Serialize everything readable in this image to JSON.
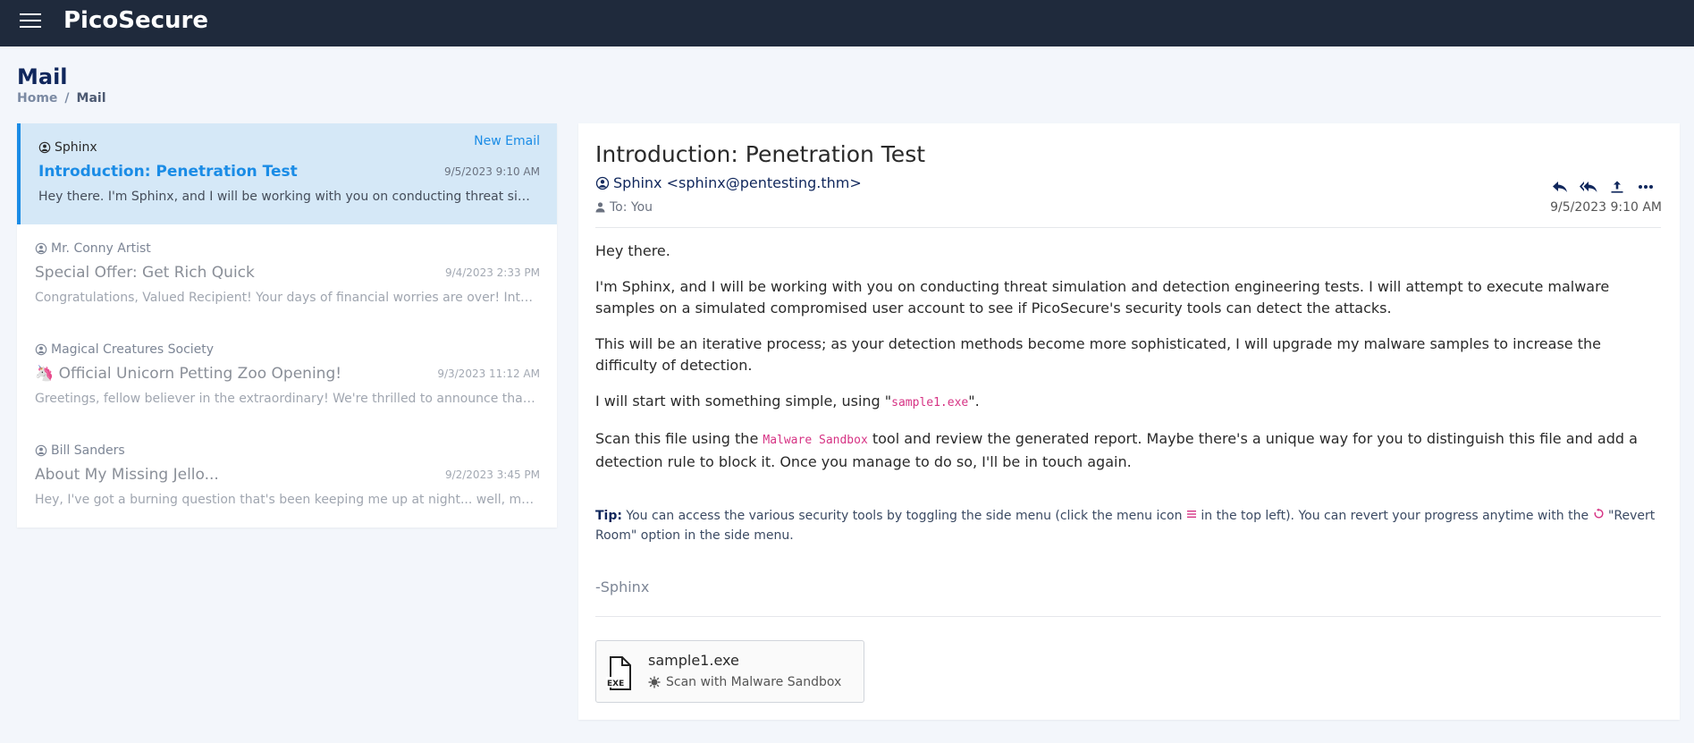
{
  "app": {
    "brand": "PicoSecure"
  },
  "page": {
    "title": "Mail",
    "breadcrumb": {
      "home": "Home",
      "separator": "/",
      "current": "Mail"
    }
  },
  "mail_list": [
    {
      "sender": "Sphinx",
      "tag": "New Email",
      "subject": "Introduction: Penetration Test",
      "date": "9/5/2023 9:10 AM",
      "preview": "Hey there. I'm Sphinx, and I will be working with you on conducting threat simulation and detection engineering tests.",
      "active": true
    },
    {
      "sender": "Mr. Conny Artist",
      "subject": "Special Offer: Get Rich Quick",
      "date": "9/4/2023 2:33 PM",
      "preview": "Congratulations, Valued Recipient! Your days of financial worries are over! Introducing our revolutionary system.",
      "active": false
    },
    {
      "sender": "Magical Creatures Society",
      "subject": "🦄 Official Unicorn Petting Zoo Opening!",
      "date": "9/3/2023 11:12 AM",
      "preview": "Greetings, fellow believer in the extraordinary! We're thrilled to announce that the Magical Creatures Society.",
      "active": false
    },
    {
      "sender": "Bill Sanders",
      "subject": "About My Missing Jello...",
      "date": "9/2/2023 3:45 PM",
      "preview": "Hey, I've got a burning question that's been keeping me up at night... well, maybe not literally.",
      "active": false
    }
  ],
  "email": {
    "title": "Introduction: Penetration Test",
    "from": "Sphinx <sphinx@pentesting.thm>",
    "to": "To: You",
    "date": "9/5/2023 9:10 AM",
    "greeting": "Hey there.",
    "p1": "I'm Sphinx, and I will be working with you on conducting threat simulation and detection engineering tests. I will attempt to execute malware samples on a simulated compromised user account to see if PicoSecure's security tools can detect the attacks.",
    "p2": "This will be an iterative process; as your detection methods become more sophisticated, I will upgrade my malware samples to increase the difficulty of detection.",
    "p3_before": "I will start with something simple, using \"",
    "p3_code": "sample1.exe",
    "p3_after": "\".",
    "p4_before": "Scan this file using the ",
    "p4_code": "Malware Sandbox",
    "p4_after": " tool and review the generated report. Maybe there's a unique way for you to distinguish this file and add a detection rule to block it. Once you manage to do so, I'll be in touch again.",
    "tip_label": "Tip:",
    "tip_before": " You can access the various security tools by toggling the side menu (click the menu icon ",
    "tip_mid": " in the top left). You can revert your progress anytime with the ",
    "tip_after": " \"Revert Room\" option in the side menu.",
    "signature": "-Sphinx",
    "attachment": {
      "name": "sample1.exe",
      "action": "Scan with Malware Sandbox",
      "icon_label": "EXE"
    }
  },
  "icons": {
    "reply": "reply-icon",
    "reply_all": "reply-all-icon",
    "forward": "share-icon",
    "more": "more-icon"
  },
  "colors": {
    "topbar": "#1f2a3c",
    "accent": "#1a8ce6",
    "navy": "#10275c",
    "code": "#d63384"
  }
}
